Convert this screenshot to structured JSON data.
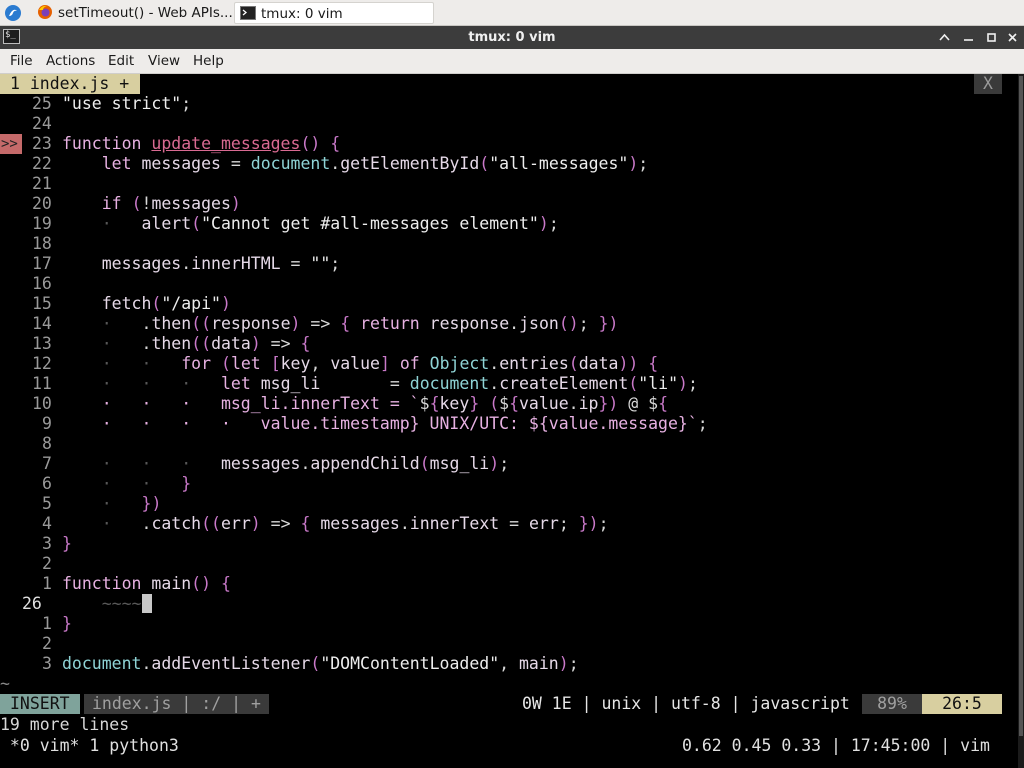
{
  "taskbar": {
    "tasks": [
      {
        "label": "setTimeout() - Web APIs..."
      },
      {
        "label": "tmux: 0 vim"
      }
    ]
  },
  "window": {
    "title": "tmux: 0 vim"
  },
  "menu": {
    "items": [
      "File",
      "Actions",
      "Edit",
      "View",
      "Help"
    ]
  },
  "vim": {
    "buffer_tab": "1 index.js +",
    "close_label": "X",
    "sign": ">>",
    "tilde": "~",
    "mode": "INSERT",
    "status_file": "index.js | :/ | +",
    "status_info": "0W 1E | unix | utf-8 | javascript",
    "percent": "89%",
    "position": "26:5",
    "message": "19 more lines"
  },
  "tmux": {
    "left": " *0 vim* 1 python3",
    "right": "0.62 0.45 0.33 | 17:45:00 | vim"
  },
  "code": [
    {
      "ln": "25",
      "text": "\"use strict\";"
    },
    {
      "ln": "24",
      "text": ""
    },
    {
      "ln": "23",
      "text": "function update_messages() {"
    },
    {
      "ln": "22",
      "text": "    let messages = document.getElementById(\"all-messages\");"
    },
    {
      "ln": "21",
      "text": ""
    },
    {
      "ln": "20",
      "text": "    if (!messages)"
    },
    {
      "ln": "19",
      "text": "    ·   alert(\"Cannot get #all-messages element\");"
    },
    {
      "ln": "18",
      "text": ""
    },
    {
      "ln": "17",
      "text": "    messages.innerHTML = \"\";"
    },
    {
      "ln": "16",
      "text": ""
    },
    {
      "ln": "15",
      "text": "    fetch(\"/api\")"
    },
    {
      "ln": "14",
      "text": "    ·   .then((response) => { return response.json(); })"
    },
    {
      "ln": "13",
      "text": "    ·   .then((data) => {"
    },
    {
      "ln": "12",
      "text": "    ·   ·   for (let [key, value] of Object.entries(data)) {"
    },
    {
      "ln": "11",
      "text": "    ·   ·   ·   let msg_li       = document.createElement(\"li\");"
    },
    {
      "ln": "10",
      "text": "    ·   ·   ·   msg_li.innerText = `${key} (${value.ip}) @ ${"
    },
    {
      "ln": "9",
      "text": "    ·   ·   ·   ·   value.timestamp} UNIX/UTC: ${value.message}`;"
    },
    {
      "ln": "8",
      "text": ""
    },
    {
      "ln": "7",
      "text": "    ·   ·   ·   messages.appendChild(msg_li);"
    },
    {
      "ln": "6",
      "text": "    ·   ·   }"
    },
    {
      "ln": "5",
      "text": "    ·   })"
    },
    {
      "ln": "4",
      "text": "    ·   .catch((err) => { messages.innerText = err; });"
    },
    {
      "ln": "3",
      "text": "}"
    },
    {
      "ln": "2",
      "text": ""
    },
    {
      "ln": "1",
      "text": "function main() {"
    },
    {
      "ln": "26",
      "text": "    ~~~~"
    },
    {
      "ln": "1",
      "text": "}"
    },
    {
      "ln": "2",
      "text": ""
    },
    {
      "ln": "3",
      "text": "document.addEventListener(\"DOMContentLoaded\", main);"
    }
  ]
}
